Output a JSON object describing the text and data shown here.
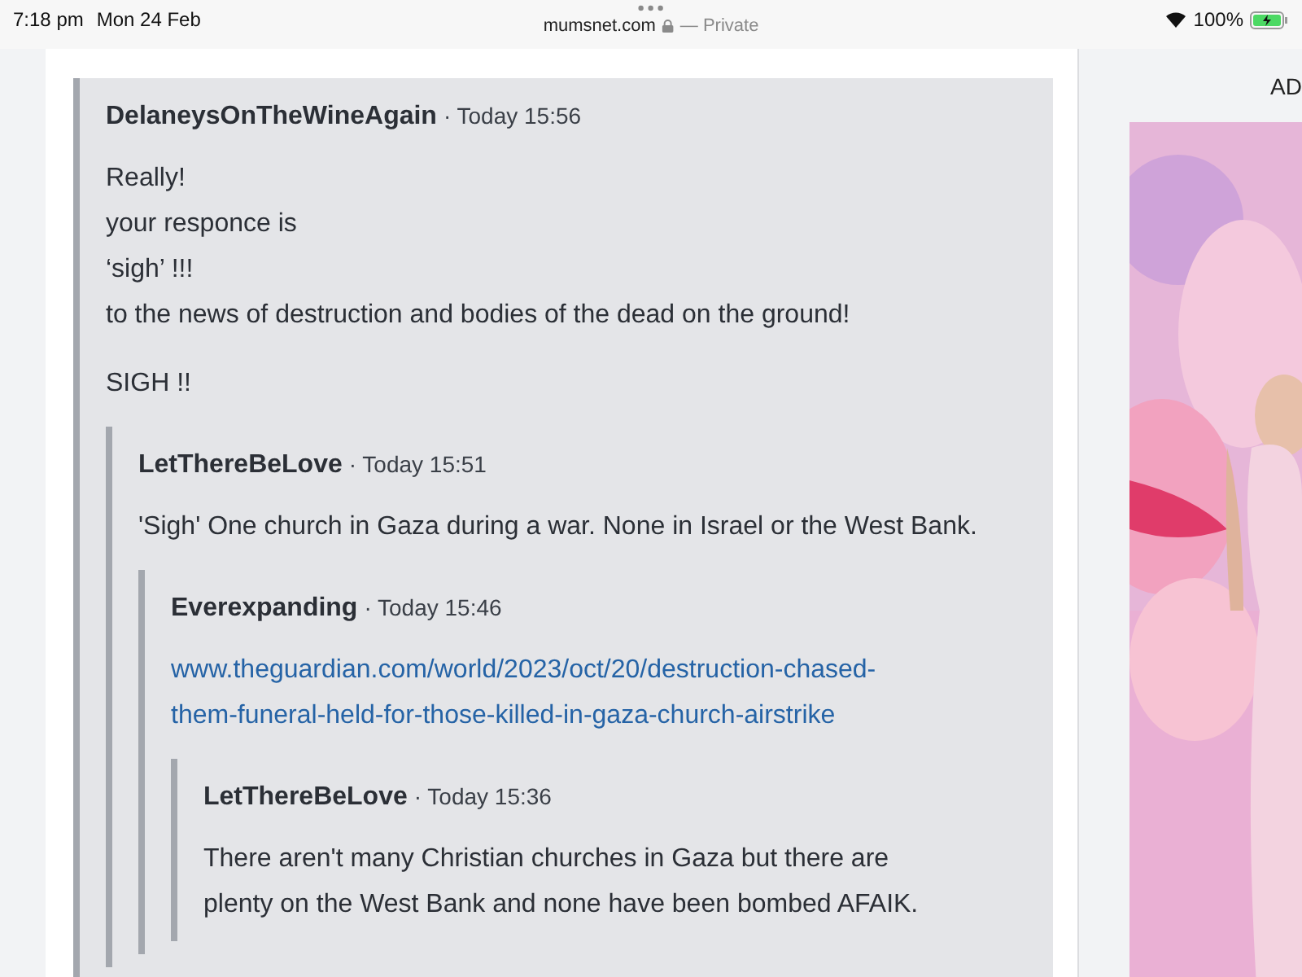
{
  "status_bar": {
    "time": "7:18 pm",
    "date": "Mon 24 Feb",
    "url": "mumsnet.com",
    "private_label": "— Private",
    "battery": "100%"
  },
  "sidebar": {
    "ad_label": "AD"
  },
  "thread": {
    "author": "DelaneysOnTheWineAgain",
    "time": "· Today 15:56",
    "body": [
      {
        "kind": "text",
        "text": "Really!\nyour responce is\n‘sigh’ !!!\nto the news of destruction and bodies of the dead on the ground!"
      },
      {
        "kind": "text",
        "text": "SIGH !!"
      }
    ],
    "children": [
      {
        "author": "LetThereBeLove",
        "time": "· Today 15:51",
        "body": [
          {
            "kind": "text",
            "text": "'Sigh' One church in Gaza during a war. None in Israel or the West Bank."
          }
        ],
        "children": [
          {
            "author": "Everexpanding",
            "time": "· Today 15:46",
            "body": [
              {
                "kind": "link",
                "text": "www.theguardian.com/world/2023/oct/20/destruction-chased-\nthem-funeral-held-for-those-killed-in-gaza-church-airstrike"
              }
            ],
            "children": [
              {
                "author": "LetThereBeLove",
                "time": "· Today 15:36",
                "body": [
                  {
                    "kind": "text",
                    "text": "There aren't many Christian churches in Gaza but there are\nplenty on the West Bank and none have been bombed AFAIK."
                  }
                ]
              }
            ]
          }
        ]
      }
    ]
  }
}
